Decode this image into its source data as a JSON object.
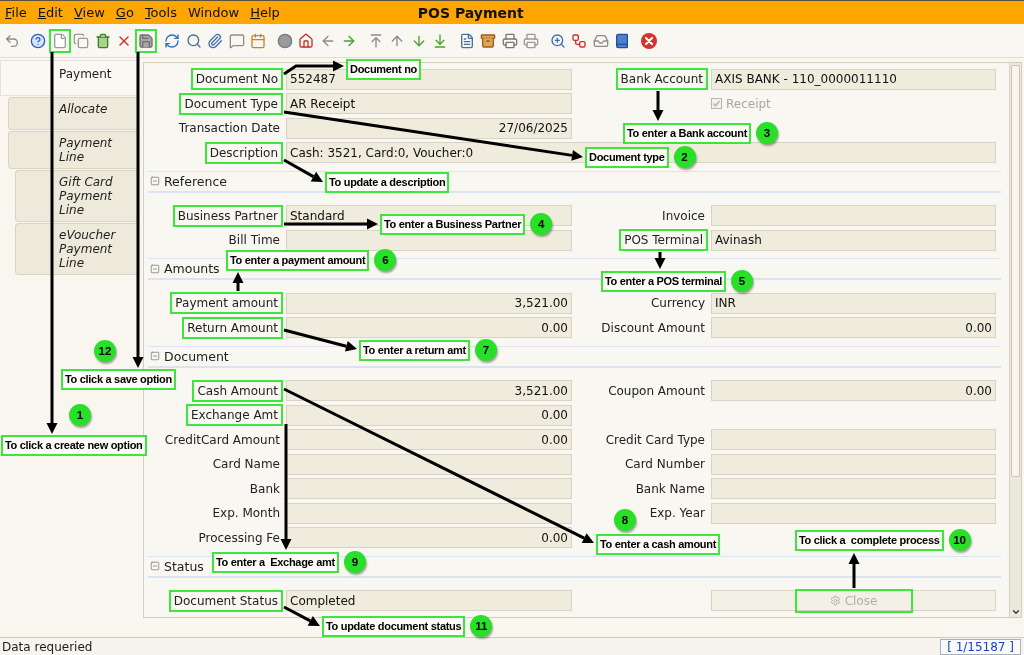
{
  "window": {
    "title": "POS Payment"
  },
  "menu": [
    {
      "label": "File",
      "mnemonic": true
    },
    {
      "label": "Edit",
      "mnemonic": true
    },
    {
      "label": "View",
      "mnemonic": true
    },
    {
      "label": "Go",
      "mnemonic": true
    },
    {
      "label": "Tools",
      "mnemonic": true
    },
    {
      "label": "Window",
      "mnemonic": false
    },
    {
      "label": "Help",
      "mnemonic": true
    }
  ],
  "toolbar": {
    "groups": [
      {
        "buttons": [
          {
            "kind": "undo",
            "highlighted": false
          }
        ]
      },
      {
        "buttons": [
          {
            "kind": "help",
            "highlighted": false
          },
          {
            "kind": "new",
            "highlighted": true
          },
          {
            "kind": "copy",
            "highlighted": false
          },
          {
            "kind": "trash",
            "highlighted": false
          },
          {
            "kind": "delete",
            "highlighted": false
          },
          {
            "kind": "save",
            "highlighted": true
          }
        ]
      },
      {
        "buttons": [
          {
            "kind": "refresh",
            "highlighted": false
          },
          {
            "kind": "find",
            "highlighted": false
          },
          {
            "kind": "attach",
            "highlighted": false
          },
          {
            "kind": "chat",
            "highlighted": false
          },
          {
            "kind": "calendar",
            "highlighted": false
          }
        ]
      },
      {
        "buttons": [
          {
            "kind": "history",
            "highlighted": false
          },
          {
            "kind": "home",
            "highlighted": false
          },
          {
            "kind": "back",
            "highlighted": false
          },
          {
            "kind": "forward",
            "highlighted": false
          }
        ]
      },
      {
        "buttons": [
          {
            "kind": "first",
            "highlighted": false
          },
          {
            "kind": "up",
            "highlighted": false
          },
          {
            "kind": "down",
            "highlighted": false
          },
          {
            "kind": "last",
            "highlighted": false
          }
        ]
      },
      {
        "buttons": [
          {
            "kind": "report",
            "highlighted": false
          },
          {
            "kind": "archive",
            "highlighted": false
          },
          {
            "kind": "print",
            "highlighted": false
          },
          {
            "kind": "preview",
            "highlighted": false
          }
        ]
      },
      {
        "buttons": [
          {
            "kind": "zoom",
            "highlighted": false
          },
          {
            "kind": "workflow",
            "highlighted": false
          },
          {
            "kind": "request",
            "highlighted": false
          },
          {
            "kind": "product",
            "highlighted": false
          }
        ]
      },
      {
        "buttons": [
          {
            "kind": "close",
            "highlighted": false
          }
        ]
      }
    ]
  },
  "tabs": [
    {
      "label": "Payment",
      "selected": true,
      "children": [
        {
          "label": "Allocate",
          "selected": false
        },
        {
          "label": "Payment Line",
          "selected": false,
          "children": [
            {
              "label": "Gift Card Payment Line",
              "selected": false
            },
            {
              "label": "eVoucher Payment Line",
              "selected": false
            }
          ]
        }
      ]
    }
  ],
  "form": {
    "sections": [
      {
        "rows": [
          {
            "left": {
              "kind": "text",
              "label": "Document No",
              "value": "552487",
              "highlighted": true
            },
            "right": {
              "kind": "text",
              "label": "Bank Account",
              "value": "AXIS BANK - 110_0000011110",
              "highlighted": true
            }
          },
          {
            "left": {
              "kind": "text",
              "label": "Document Type",
              "value": "AR Receipt",
              "highlighted": true
            },
            "right": {
              "kind": "checkbox",
              "label": "Receipt",
              "checked": true,
              "disabled": true
            }
          },
          {
            "left": {
              "kind": "date",
              "label": "Transaction Date",
              "value": "27/06/2025",
              "highlighted": false
            }
          },
          {
            "left": {
              "kind": "wide",
              "label": "Description",
              "value": "Cash: 3521, Card:0, Voucher:0",
              "highlighted": true
            }
          }
        ]
      },
      {
        "title": "Reference",
        "expanded": true,
        "rows": [
          {
            "left": {
              "kind": "text",
              "label": "Business Partner",
              "value": "Standard",
              "highlighted": true
            },
            "right": {
              "kind": "text",
              "label": "Invoice",
              "highlighted": false
            }
          },
          {
            "left": {
              "kind": "text",
              "label": "Bill Time",
              "highlighted": false
            },
            "right": {
              "kind": "text",
              "label": "POS Terminal",
              "value": "Avinash",
              "highlighted": true
            }
          }
        ]
      },
      {
        "title": "Amounts",
        "expanded": true,
        "rows": [
          {
            "left": {
              "kind": "amount",
              "label": "Payment amount",
              "value": "3,521.00",
              "highlighted": true
            },
            "right": {
              "kind": "text",
              "label": "Currency",
              "value": "INR",
              "highlighted": false
            }
          },
          {
            "left": {
              "kind": "amount",
              "label": "Return Amount",
              "value": "0.00",
              "highlighted": true
            },
            "right": {
              "kind": "amount",
              "label": "Discount Amount",
              "value": "0.00",
              "highlighted": false
            }
          }
        ]
      },
      {
        "title": "Document",
        "expanded": true,
        "rows": [
          {
            "left": {
              "kind": "amount",
              "label": "Cash Amount",
              "value": "3,521.00",
              "highlighted": true
            },
            "right": {
              "kind": "amount",
              "label": "Coupon Amount",
              "value": "0.00",
              "highlighted": false
            }
          },
          {
            "left": {
              "kind": "amount",
              "label": "Exchange Amt",
              "value": "0.00",
              "highlighted": true
            }
          },
          {
            "left": {
              "kind": "amount",
              "label": "CreditCard Amount",
              "value": "0.00",
              "highlighted": false
            },
            "right": {
              "kind": "text",
              "label": "Credit Card Type",
              "highlighted": false
            }
          },
          {
            "left": {
              "kind": "text",
              "label": "Card Name",
              "highlighted": false
            },
            "right": {
              "kind": "text",
              "label": "Card Number",
              "highlighted": false
            }
          },
          {
            "left": {
              "kind": "text",
              "label": "Bank",
              "highlighted": false
            },
            "right": {
              "kind": "text",
              "label": "Bank Name",
              "highlighted": false
            }
          },
          {
            "left": {
              "kind": "text",
              "label": "Exp. Month",
              "highlighted": false
            },
            "right": {
              "kind": "text",
              "label": "Exp. Year",
              "highlighted": false
            }
          },
          {
            "left": {
              "kind": "amount",
              "label": "Processing Fe",
              "value": "0.00",
              "highlighted": false
            }
          }
        ]
      },
      {
        "title": "Status",
        "expanded": true,
        "rows": [
          {
            "left": {
              "kind": "text",
              "label": "Document Status",
              "value": "Completed",
              "highlighted": true
            },
            "right": {
              "kind": "button",
              "label": "Close",
              "disabled": true,
              "highlighted": true
            }
          }
        ]
      }
    ]
  },
  "annotations": [
    {
      "text": "Document no"
    },
    {
      "number": "3",
      "text": "To enter a Bank account"
    },
    {
      "number": "2",
      "text": "Document type"
    },
    {
      "text": "To update a description"
    },
    {
      "number": "4",
      "text": "To enter a Business Partner"
    },
    {
      "number": "6",
      "text": "To enter a payment amount"
    },
    {
      "number": "5",
      "text": "To enter a POS terminal"
    },
    {
      "number": "12",
      "text": "To click a save option"
    },
    {
      "number": "7",
      "text": "To enter a return amt"
    },
    {
      "number": "1",
      "text": "To click a create new option"
    },
    {
      "number": "8",
      "text": "To enter a cash amount"
    },
    {
      "number": "10",
      "text": "To click a  complete process"
    },
    {
      "number": "9",
      "text": "To enter a  Exchage amt"
    },
    {
      "number": "11",
      "text": "To update document status"
    }
  ],
  "status_bar": {
    "message": "Data requeried",
    "record": "[ 1/15187 ]"
  }
}
